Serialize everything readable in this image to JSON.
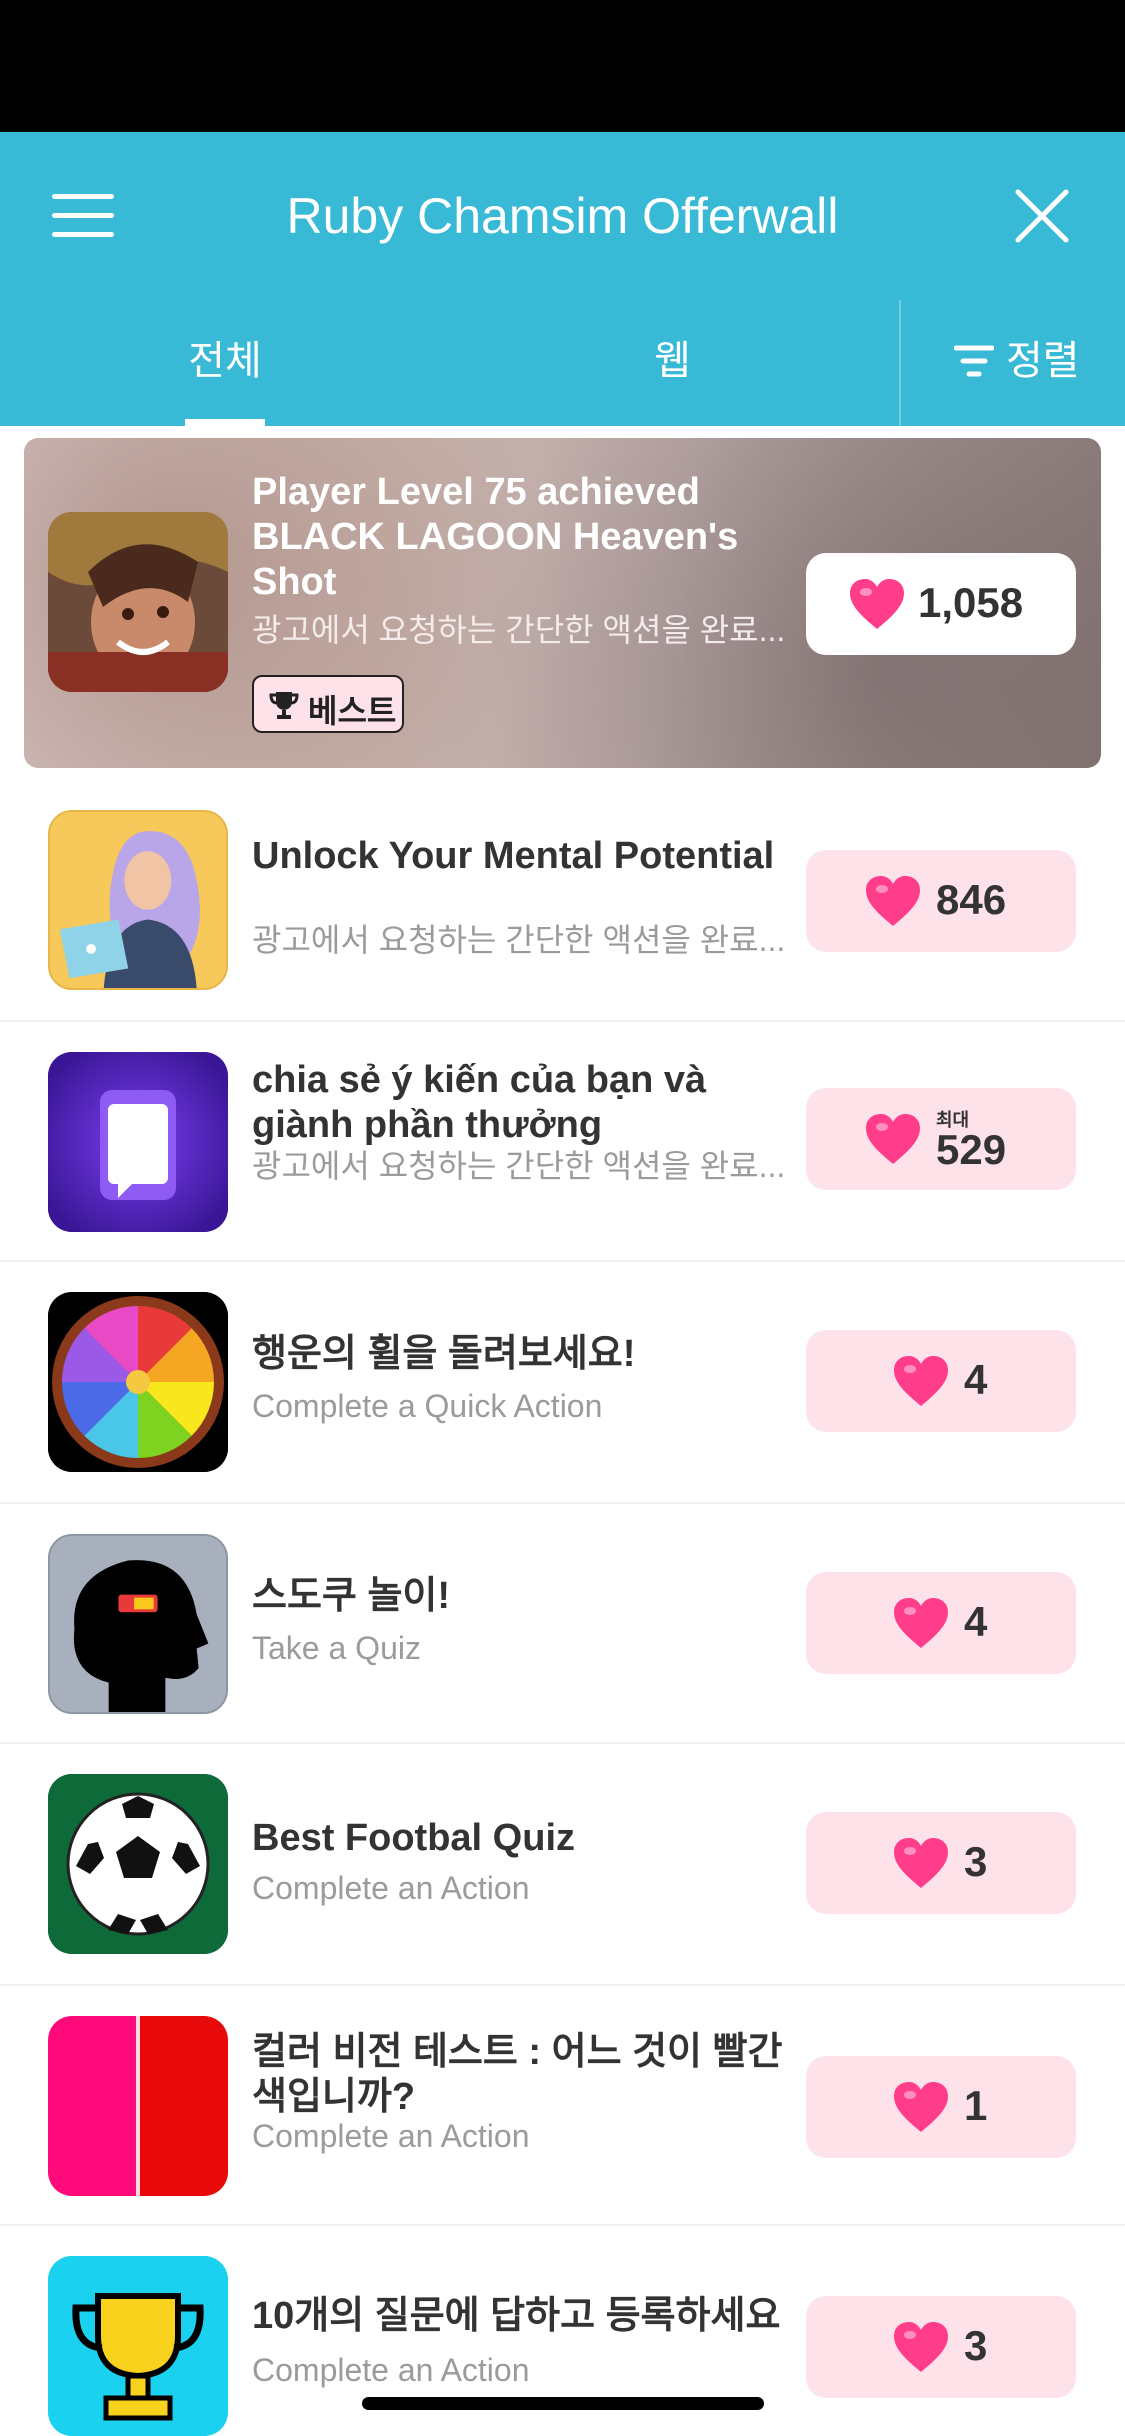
{
  "header": {
    "title": "Ruby Chamsim Offerwall",
    "menu_icon": "hamburger-menu-icon",
    "close_icon": "close-icon",
    "background": "#38b9d6"
  },
  "tabs": {
    "all": "전체",
    "web": "웹",
    "sort": "정렬",
    "active": "all"
  },
  "offers": [
    {
      "title": "Player Level 75 achieved BLACK LAGOON Heaven's Shot",
      "description": "광고에서 요청하는 간단한 액션을 완료...",
      "badge": "베스트",
      "reward": "1,058",
      "icon": "anime-character-thumbnail"
    },
    {
      "title": "Unlock Your Mental Potential",
      "description": "광고에서 요청하는 간단한 액션을 완료...",
      "reward": "846",
      "icon": "woman-laptop-thumbnail"
    },
    {
      "title": "chia sẻ ý kiến của bạn và giành phần thưởng",
      "description": "광고에서 요청하는 간단한 액션을 완료...",
      "reward_prefix": "최대",
      "reward": "529",
      "icon": "phone-chat-thumbnail"
    },
    {
      "title": "행운의 휠을 돌려보세요!",
      "description": "Complete a Quick Action",
      "reward": "4",
      "icon": "fortune-wheel-thumbnail"
    },
    {
      "title": "스도쿠 놀이!",
      "description": "Take a Quiz",
      "reward": "4",
      "icon": "head-battery-thumbnail"
    },
    {
      "title": "Best Footbal Quiz",
      "description": "Complete an Action",
      "reward": "3",
      "icon": "soccer-ball-thumbnail"
    },
    {
      "title": "컬러 비전 테스트 : 어느 것이 빨간색입니까?",
      "description": "Complete an Action",
      "reward": "1",
      "icon": "red-pink-split-thumbnail"
    },
    {
      "title": "10개의 질문에 답하고 등록하세요",
      "description": "Complete an Action",
      "reward": "3",
      "icon": "trophy-thumbnail"
    }
  ],
  "colors": {
    "reward_bg": "#fde2ea",
    "heart": "#ff3d8b",
    "title_text": "#333333",
    "desc_text": "#9b9b9b"
  }
}
